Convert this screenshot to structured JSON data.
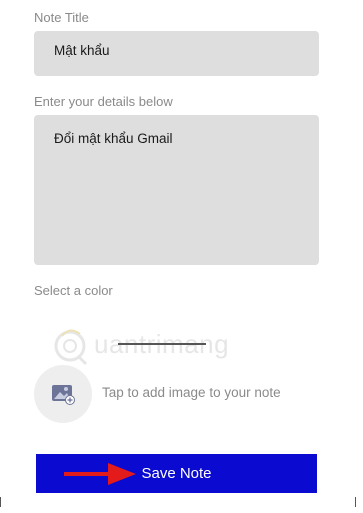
{
  "note_title": {
    "label": "Note Title",
    "value": "Mật khẩu"
  },
  "details": {
    "label": "Enter your details below",
    "value": "Đổi mật khẩu Gmail"
  },
  "color": {
    "label": "Select a color"
  },
  "image": {
    "icon": "add-image-icon",
    "caption": "Tap to add image to your note"
  },
  "save": {
    "label": "Save Note",
    "color": "#0a0ad0"
  },
  "watermark": {
    "brand": "uantrimang"
  },
  "annotation": {
    "arrow_color": "#e31b1b"
  }
}
